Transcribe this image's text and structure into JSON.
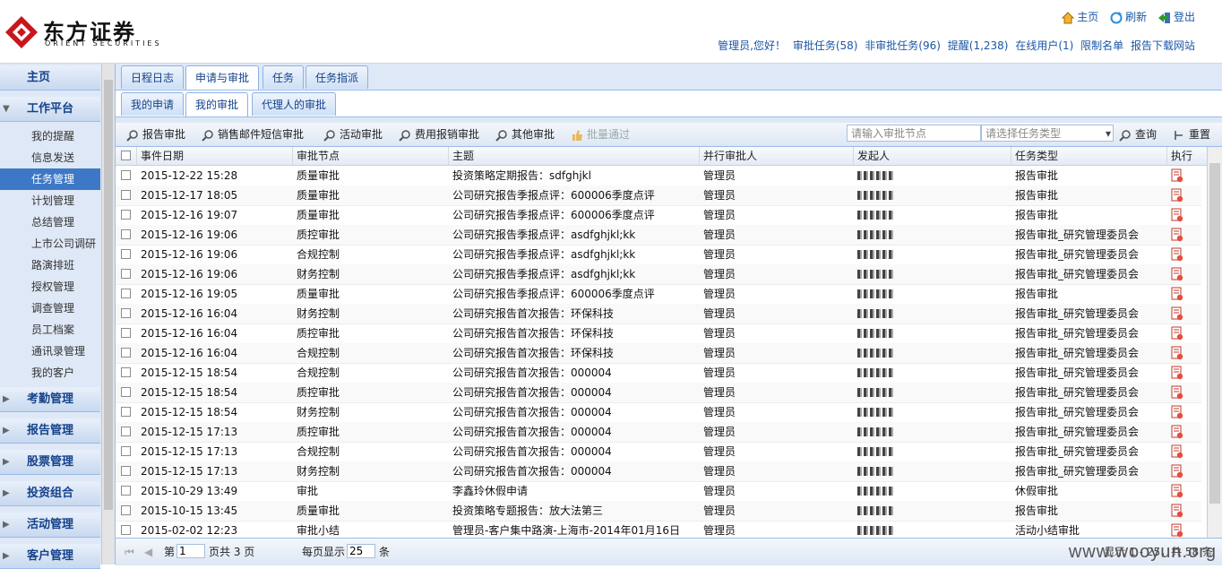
{
  "brand": {
    "cn": "东方证券",
    "en": "ORIENT SECURITIES"
  },
  "top_links": {
    "home": "主页",
    "refresh": "刷新",
    "logout": "登出"
  },
  "status_bar": {
    "greeting": "管理员,您好！",
    "approval_tasks": "审批任务(58)",
    "non_approval_tasks": "非审批任务(96)",
    "reminders": "提醒(1,238)",
    "online_users": "在线用户(1)",
    "restricted_list": "限制名单",
    "report_download": "报告下载网站"
  },
  "sidebar": {
    "sections_top": [
      {
        "label": "主页"
      },
      {
        "label": "工作平台"
      }
    ],
    "items": [
      {
        "label": "我的提醒"
      },
      {
        "label": "信息发送"
      },
      {
        "label": "任务管理"
      },
      {
        "label": "计划管理"
      },
      {
        "label": "总结管理"
      },
      {
        "label": "上市公司调研"
      },
      {
        "label": "路演排班"
      },
      {
        "label": "授权管理"
      },
      {
        "label": "调查管理"
      },
      {
        "label": "员工档案"
      },
      {
        "label": "通讯录管理"
      },
      {
        "label": "我的客户"
      }
    ],
    "sections_bottom": [
      {
        "label": "考勤管理"
      },
      {
        "label": "报告管理"
      },
      {
        "label": "股票管理"
      },
      {
        "label": "投资组合"
      },
      {
        "label": "活动管理"
      },
      {
        "label": "客户管理"
      }
    ]
  },
  "main_tabs": [
    {
      "label": "日程日志"
    },
    {
      "label": "申请与审批"
    },
    {
      "label": "任务"
    },
    {
      "label": "任务指派"
    }
  ],
  "sub_tabs": [
    {
      "label": "我的申请"
    },
    {
      "label": "我的审批"
    },
    {
      "label": "代理人的审批"
    }
  ],
  "toolbar": {
    "buttons": [
      "报告审批",
      "销售邮件短信审批",
      "活动审批",
      "费用报销审批",
      "其他审批",
      "批量通过"
    ],
    "node_placeholder": "请输入审批节点",
    "type_placeholder": "请选择任务类型",
    "query": "查询",
    "reset": "重置"
  },
  "columns": [
    "事件日期",
    "审批节点",
    "主题",
    "并行审批人",
    "发起人",
    "任务类型",
    "执行"
  ],
  "rows": [
    {
      "date": "2015-12-22 15:28",
      "node": "质量审批",
      "subject": "投资策略定期报告：sdfghjkl",
      "approver": "管理员",
      "type": "报告审批"
    },
    {
      "date": "2015-12-17 18:05",
      "node": "质量审批",
      "subject": "公司研究报告季报点评：600006季度点评",
      "approver": "管理员",
      "type": "报告审批"
    },
    {
      "date": "2015-12-16 19:07",
      "node": "质量审批",
      "subject": "公司研究报告季报点评：600006季度点评",
      "approver": "管理员",
      "type": "报告审批"
    },
    {
      "date": "2015-12-16 19:06",
      "node": "质控审批",
      "subject": "公司研究报告季报点评：asdfghjkl;kk",
      "approver": "管理员",
      "type": "报告审批_研究管理委员会"
    },
    {
      "date": "2015-12-16 19:06",
      "node": "合规控制",
      "subject": "公司研究报告季报点评：asdfghjkl;kk",
      "approver": "管理员",
      "type": "报告审批_研究管理委员会"
    },
    {
      "date": "2015-12-16 19:06",
      "node": "财务控制",
      "subject": "公司研究报告季报点评：asdfghjkl;kk",
      "approver": "管理员",
      "type": "报告审批_研究管理委员会"
    },
    {
      "date": "2015-12-16 19:05",
      "node": "质量审批",
      "subject": "公司研究报告季报点评：600006季度点评",
      "approver": "管理员",
      "type": "报告审批"
    },
    {
      "date": "2015-12-16 16:04",
      "node": "财务控制",
      "subject": "公司研究报告首次报告：环保科技",
      "approver": "管理员",
      "type": "报告审批_研究管理委员会"
    },
    {
      "date": "2015-12-16 16:04",
      "node": "质控审批",
      "subject": "公司研究报告首次报告：环保科技",
      "approver": "管理员",
      "type": "报告审批_研究管理委员会"
    },
    {
      "date": "2015-12-16 16:04",
      "node": "合规控制",
      "subject": "公司研究报告首次报告：环保科技",
      "approver": "管理员",
      "type": "报告审批_研究管理委员会"
    },
    {
      "date": "2015-12-15 18:54",
      "node": "合规控制",
      "subject": "公司研究报告首次报告：000004",
      "approver": "管理员",
      "type": "报告审批_研究管理委员会"
    },
    {
      "date": "2015-12-15 18:54",
      "node": "质控审批",
      "subject": "公司研究报告首次报告：000004",
      "approver": "管理员",
      "type": "报告审批_研究管理委员会"
    },
    {
      "date": "2015-12-15 18:54",
      "node": "财务控制",
      "subject": "公司研究报告首次报告：000004",
      "approver": "管理员",
      "type": "报告审批_研究管理委员会"
    },
    {
      "date": "2015-12-15 17:13",
      "node": "质控审批",
      "subject": "公司研究报告首次报告：000004",
      "approver": "管理员",
      "type": "报告审批_研究管理委员会"
    },
    {
      "date": "2015-12-15 17:13",
      "node": "合规控制",
      "subject": "公司研究报告首次报告：000004",
      "approver": "管理员",
      "type": "报告审批_研究管理委员会"
    },
    {
      "date": "2015-12-15 17:13",
      "node": "财务控制",
      "subject": "公司研究报告首次报告：000004",
      "approver": "管理员",
      "type": "报告审批_研究管理委员会"
    },
    {
      "date": "2015-10-29 13:49",
      "node": "审批",
      "subject": "李鑫玲休假申请",
      "approver": "管理员",
      "type": "休假审批"
    },
    {
      "date": "2015-10-15 13:45",
      "node": "质量审批",
      "subject": "投资策略专题报告：放大法第三",
      "approver": "管理员",
      "type": "报告审批"
    },
    {
      "date": "2015-02-02 12:23",
      "node": "审批小结",
      "subject": "管理员-客户集中路演-上海市-2014年01月16日",
      "approver": "管理员",
      "type": "活动小结审批"
    }
  ],
  "pager": {
    "page_prefix": "第",
    "page_value": "1",
    "page_suffix": "页共 3 页",
    "per_page_label": "每页显示",
    "per_page_value": "25",
    "per_page_unit": "条",
    "summary": "显示 1 - 25，共 58 条"
  },
  "watermark": "www.wooyun.org"
}
